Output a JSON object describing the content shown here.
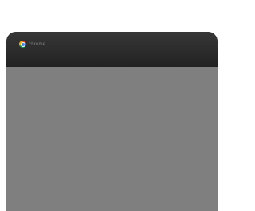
{
  "device": {
    "brand_label": "chrome",
    "icon": "chrome-logo-icon"
  },
  "colors": {
    "bezel": "#222222",
    "screen": "#7f7f7f",
    "brand_text": "#7f7f7f"
  }
}
